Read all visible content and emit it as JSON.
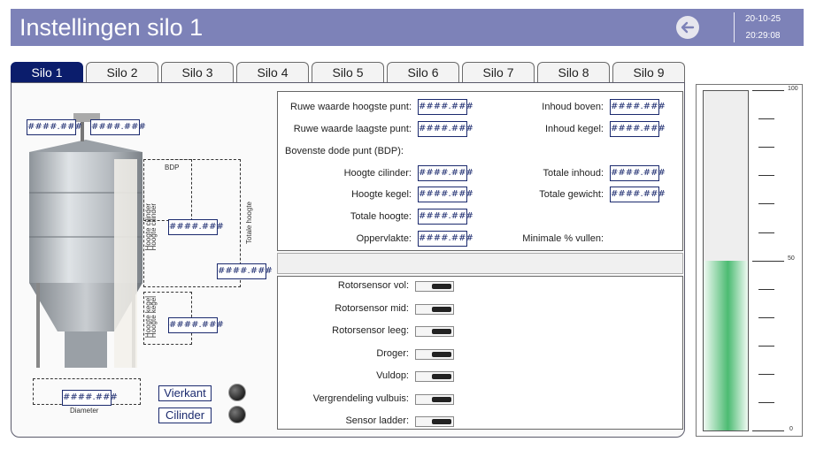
{
  "header": {
    "title": "Instellingen silo 1",
    "date": "20-10-25",
    "time": "20:29:08",
    "back_icon": "arrow-left-icon"
  },
  "tabs": [
    "Silo 1",
    "Silo 2",
    "Silo 3",
    "Silo 4",
    "Silo 5",
    "Silo 6",
    "Silo 7",
    "Silo 8",
    "Silo 9"
  ],
  "active_tab": "Silo 1",
  "diagram": {
    "placeholder": "####.###",
    "bdp_label": "BDP",
    "hoogte_cilinder": "Hoogte cilinder",
    "hoogte_cilinder_overlap": "Hoogte cilinder",
    "hoogte_kegel": "Hoogte kegel",
    "hoogte_kegel_overlap": "Hoogte kegel",
    "totale_hoogte": "Totale hoogte",
    "diameter": "Diameter",
    "btn_vierkant": "Vierkant",
    "btn_cilinder": "Cilinder"
  },
  "settings": {
    "placeholder": "####.###",
    "left": [
      {
        "label": "Ruwe waarde hoogste punt:"
      },
      {
        "label": "Ruwe waarde laagste punt:"
      },
      {
        "label": "Bovenste dode punt (BDP):"
      },
      {
        "label": "Hoogte cilinder:"
      },
      {
        "label": "Hoogte kegel:"
      },
      {
        "label": "Totale hoogte:"
      },
      {
        "label": "Oppervlakte:"
      }
    ],
    "right": [
      {
        "label": "Inhoud boven:"
      },
      {
        "label": "Inhoud kegel:"
      },
      {
        "label": "Totale inhoud:"
      },
      {
        "label": "Totale gewicht:"
      },
      {
        "label": "Minimale % vullen:"
      }
    ]
  },
  "sensors": [
    {
      "label": "Rotorsensor vol:"
    },
    {
      "label": "Rotorsensor mid:"
    },
    {
      "label": "Rotorsensor leeg:"
    },
    {
      "label": "Droger:"
    },
    {
      "label": "Vuldop:"
    },
    {
      "label": "Vergrendeling vulbuis:"
    },
    {
      "label": "Sensor ladder:"
    }
  ],
  "gauge": {
    "scale_top": "100",
    "scale_mid": "50",
    "scale_bottom": "0",
    "fill_percent": 50,
    "fill_color": "#4cbb72"
  }
}
